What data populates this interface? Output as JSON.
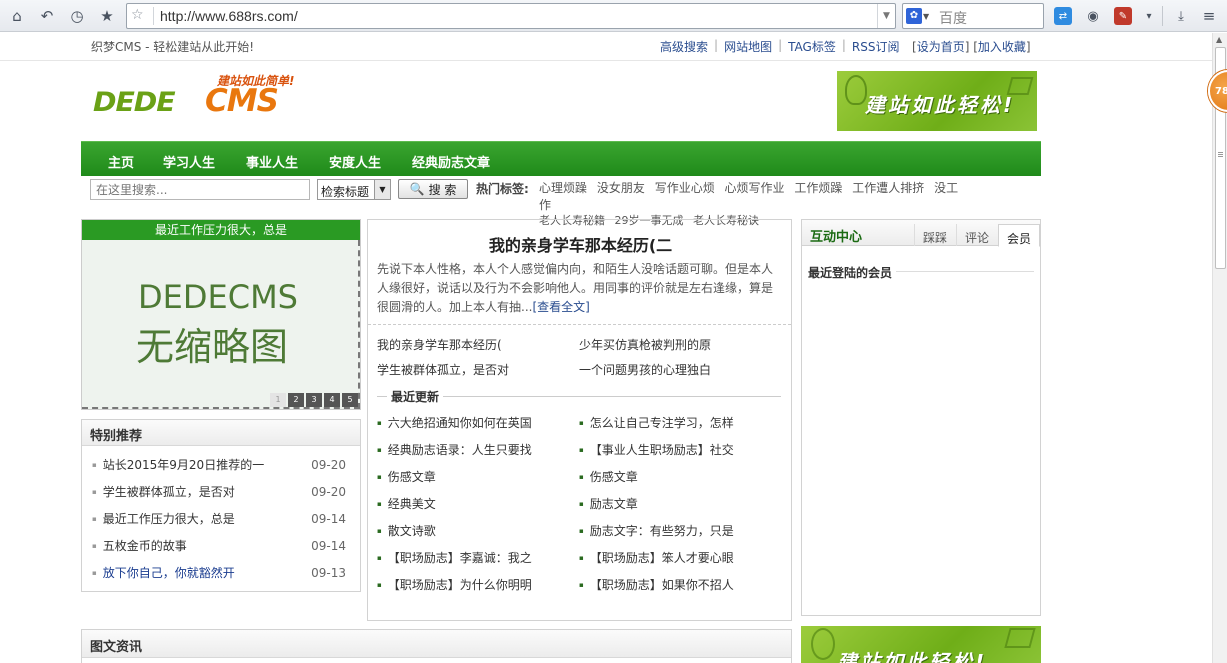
{
  "browser": {
    "url": "http://www.688rs.com/",
    "search_placeholder": "百度",
    "badge_text": "78"
  },
  "topbar": {
    "slogan": "织梦CMS - 轻松建站从此开始!",
    "links": [
      "高级搜索",
      "网站地图",
      "TAG标签",
      "RSS订阅"
    ],
    "bracket_open": "[",
    "set_home": "设为首页",
    "bracket_mid": "] [",
    "favorite": "加入收藏",
    "bracket_close": "]"
  },
  "logo": {
    "tagline": "建站如此简单!",
    "dede": "DEDE",
    "cms": "CMS"
  },
  "banner": {
    "text": "建站如此轻松!"
  },
  "nav": [
    "主页",
    "学习人生",
    "事业人生",
    "安度人生",
    "经典励志文章"
  ],
  "search": {
    "placeholder": "在这里搜索...",
    "select_value": "检索标题",
    "button": "搜 索",
    "hot_label": "热门标签:",
    "hot_tags_row1": [
      "心理烦躁",
      "没女朋友",
      "写作业心烦",
      "心烦写作业",
      "工作烦躁",
      "工作遭人排挤",
      "没工作"
    ],
    "hot_tags_row2": [
      "老人长寿秘籍",
      "29岁一事无成",
      "老人长寿秘诀"
    ]
  },
  "slide": {
    "caption": "最近工作压力很大，总是",
    "placeholder_line1": "DEDECMS",
    "placeholder_line2": "无缩略图",
    "pages": [
      "1",
      "2",
      "3",
      "4",
      "5"
    ]
  },
  "recommend": {
    "title": "特别推荐",
    "items": [
      {
        "title": "站长2015年9月20日推荐的一",
        "date": "09-20"
      },
      {
        "title": "学生被群体孤立，是否对",
        "date": "09-20"
      },
      {
        "title": "最近工作压力很大，总是",
        "date": "09-14"
      },
      {
        "title": "五枚金币的故事",
        "date": "09-14"
      },
      {
        "title": "放下你自己，你就豁然开",
        "date": "09-13"
      }
    ]
  },
  "headline": {
    "title": "我的亲身学车那本经历(二",
    "intro": "先说下本人性格，本人个人感觉偏内向，和陌生人没啥话题可聊。但是本人人缘很好，说话以及行为不会影响他人。用同事的评价就是左右逢缘，算是很圆滑的人。加上本人有抽...",
    "more": "[查看全文]",
    "pairs": [
      "我的亲身学车那本经历(",
      "少年买仿真枪被判刑的原",
      "学生被群体孤立，是否对",
      "一个问题男孩的心理独白"
    ]
  },
  "recent": {
    "title": "最近更新",
    "left": [
      "六大绝招通知你如何在英国",
      "经典励志语录：人生只要找",
      "伤感文章",
      "经典美文",
      "散文诗歌",
      "【职场励志】李嘉诚：我之",
      "【职场励志】为什么你明明"
    ],
    "right": [
      "怎么让自己专注学习，怎样",
      "【事业人生职场励志】社交",
      "伤感文章",
      "励志文章",
      "励志文字：有些努力，只是",
      "【职场励志】笨人才要心眼",
      "【职场励志】如果你不招人"
    ]
  },
  "interact": {
    "title": "互动中心",
    "tabs": [
      "踩踩",
      "评论",
      "会员"
    ],
    "subtitle": "最近登陆的会员"
  },
  "picnews": {
    "title": "图文资讯"
  }
}
